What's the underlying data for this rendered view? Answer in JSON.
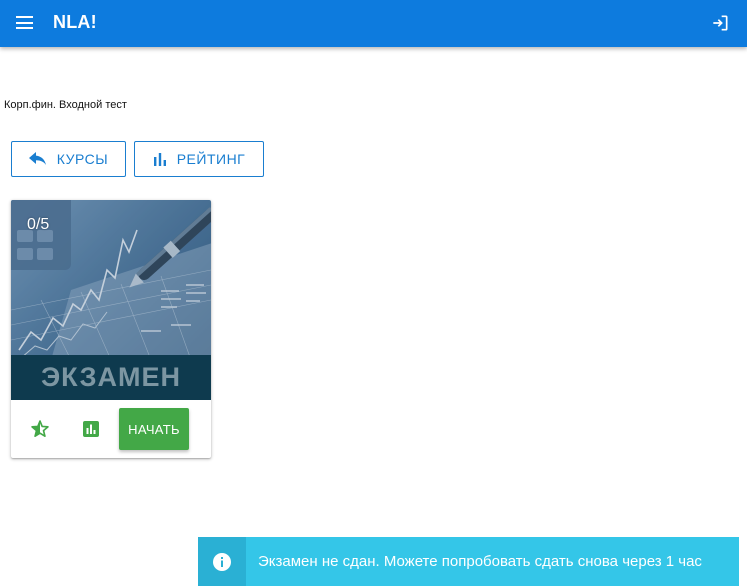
{
  "appbar": {
    "title": "NLA!",
    "color": "#0d7bde"
  },
  "breadcrumb": "Корп.фин. Входной тест",
  "nav_buttons": {
    "courses_label": "КУРСЫ",
    "rating_label": "РЕЙТИНГ"
  },
  "card": {
    "progress": "0/5",
    "banner_text": "ЭКЗАМЕН",
    "start_label": "НАЧАТЬ",
    "accent": "#43a847"
  },
  "snackbar": {
    "message": "Экзамен не сдан. Можете попробовать сдать снова через 1 час",
    "color": "#34c6e8"
  },
  "icons": {
    "menu": "menu-icon",
    "logout": "exit-to-app-icon",
    "back": "reply-icon",
    "rating": "bar-chart-icon",
    "star": "star-half-icon",
    "stats": "poll-icon",
    "info": "info-icon"
  }
}
